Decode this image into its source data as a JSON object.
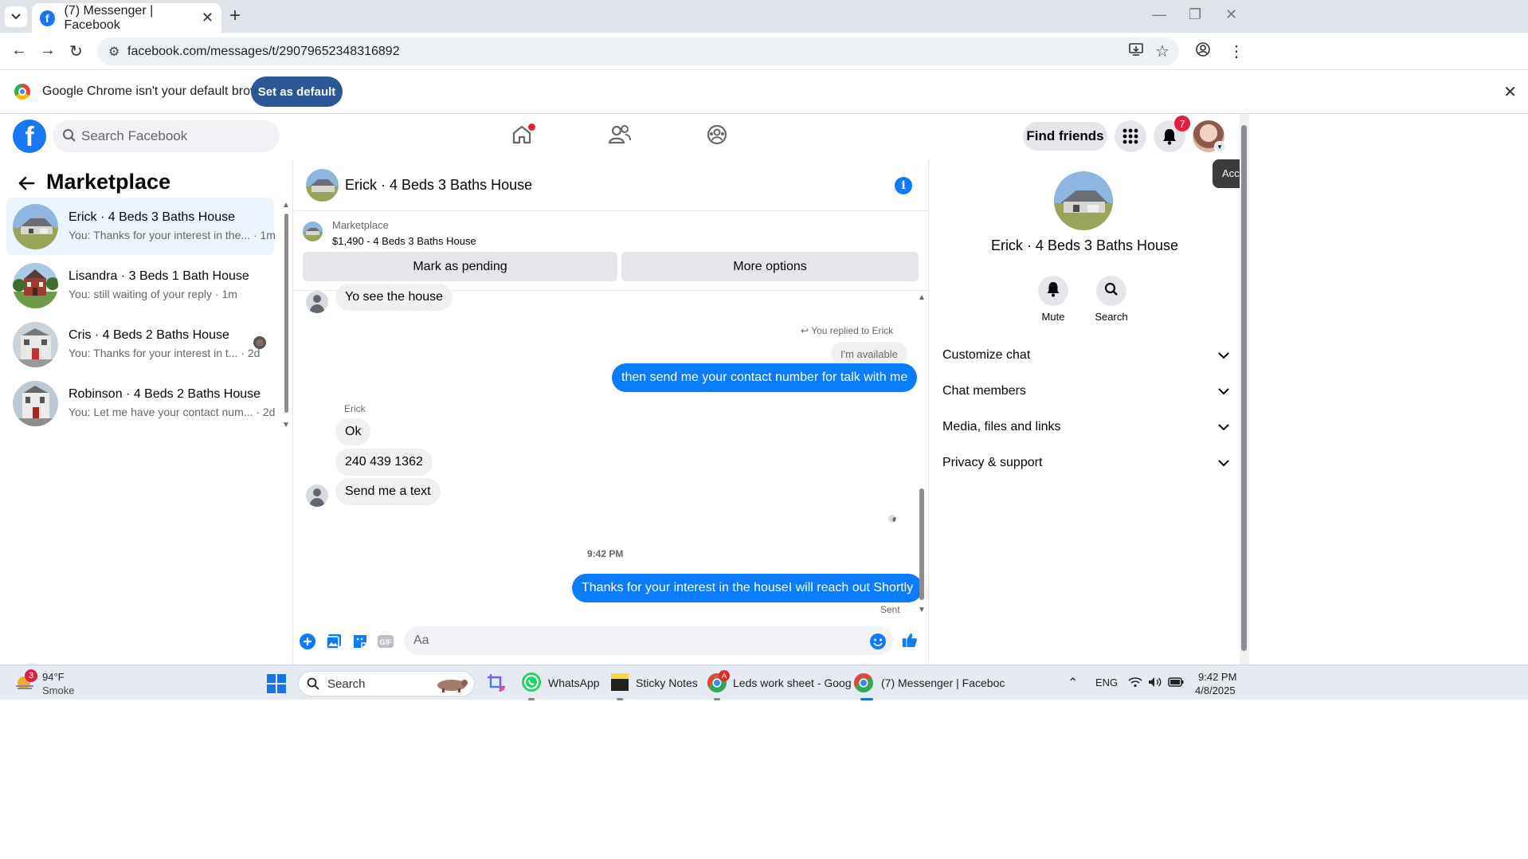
{
  "browser": {
    "tab_title": "(7) Messenger | Facebook",
    "url": "facebook.com/messages/t/29079652348316892",
    "infobar_text": "Google Chrome isn't your default browser",
    "set_default_label": "Set as default"
  },
  "fb_header": {
    "search_placeholder": "Search Facebook",
    "find_friends_label": "Find friends",
    "notification_count": "7"
  },
  "left_panel": {
    "title": "Marketplace",
    "conversations": [
      {
        "name": "Erick · 4 Beds 3 Baths House",
        "preview": "You: Thanks for your interest in the... · 1m",
        "active": true
      },
      {
        "name": "Lisandra · 3 Beds 1 Bath House",
        "preview": "You: still waiting of your reply · 1m",
        "active": false
      },
      {
        "name": "Cris · 4 Beds 2 Baths House",
        "preview": "You: Thanks for your interest in t... · 2d",
        "active": false
      },
      {
        "name": "Robinson · 4 Beds 2 Baths House",
        "preview": "You: Let me have your contact num... · 2d",
        "active": false
      }
    ]
  },
  "chat": {
    "title": "Erick · 4 Beds 3 Baths House",
    "marketplace_label": "Marketplace",
    "listing": "$1,490 - 4 Beds 3 Baths House",
    "mark_pending_label": "Mark as pending",
    "more_options_label": "More options",
    "messages": {
      "m1": "Yo see the house",
      "replied_to": "You replied to Erick",
      "quoted": "I'm available",
      "m2": "then send me your contact number for talk with me",
      "sender": "Erick",
      "m3": "Ok",
      "m4": "240 439 1362",
      "m5": "Send me a text",
      "timestamp": "9:42 PM",
      "m6": "Thanks for your interest in the houseI will reach out Shortly",
      "status": "Sent"
    },
    "composer_placeholder": "Aa"
  },
  "right_panel": {
    "name": "Erick · 4 Beds 3 Baths House",
    "mute_label": "Mute",
    "search_label": "Search",
    "rows": [
      "Customize chat",
      "Chat members",
      "Media, files and links",
      "Privacy & support"
    ],
    "tooltip": "Acc"
  },
  "taskbar": {
    "weather_temp": "94°F",
    "weather_desc": "Smoke",
    "weather_badge": "3",
    "search_label": "Search",
    "apps": [
      "WhatsApp",
      "Sticky Notes",
      "Leds work sheet - Goog",
      "(7) Messenger | Faceboc"
    ],
    "lang": "ENG",
    "time": "9:42 PM",
    "date": "4/8/2025"
  },
  "colors": {
    "fb_blue": "#1877f2",
    "messenger_blue": "#0a7cff",
    "badge_red": "#e41e3f"
  }
}
